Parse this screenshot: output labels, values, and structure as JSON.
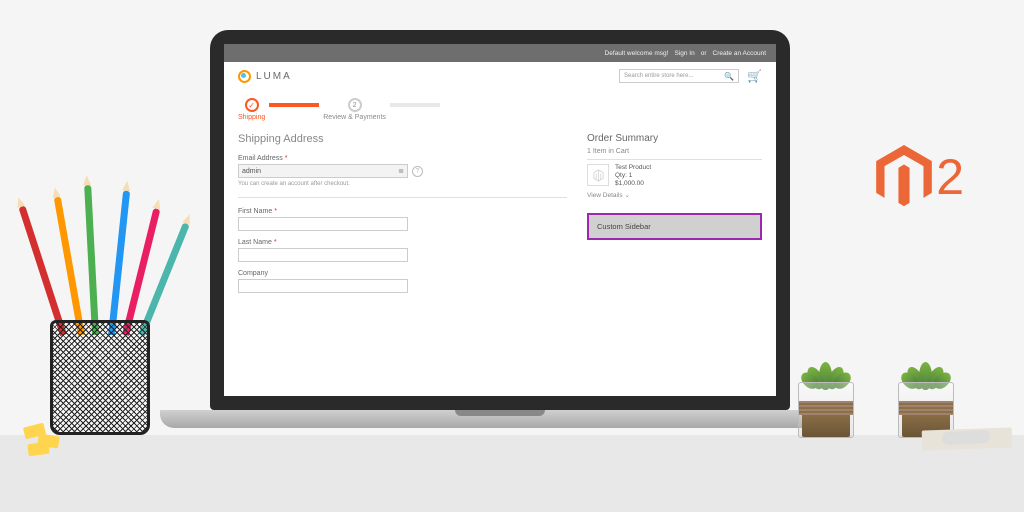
{
  "topbar": {
    "welcome": "Default welcome msg!",
    "signin": "Sign In",
    "or": "or",
    "create": "Create an Account"
  },
  "logo": {
    "text": "LUMA"
  },
  "search": {
    "placeholder": "Search entire store here..."
  },
  "progress": {
    "step1": "Shipping",
    "step2": "Review & Payments",
    "step2_num": "2"
  },
  "heading": "Shipping Address",
  "fields": {
    "email": {
      "label": "Email Address",
      "value": "admin"
    },
    "hint": "You can create an account after checkout.",
    "first": {
      "label": "First Name"
    },
    "last": {
      "label": "Last Name"
    },
    "company": {
      "label": "Company"
    }
  },
  "summary": {
    "title": "Order Summary",
    "count": "1 Item in Cart",
    "item": {
      "name": "Test Product",
      "qty": "Qty: 1",
      "price": "$1,000.00"
    },
    "view": "View Details ⌄"
  },
  "custom_sidebar": "Custom Sidebar",
  "magento_num": "2"
}
